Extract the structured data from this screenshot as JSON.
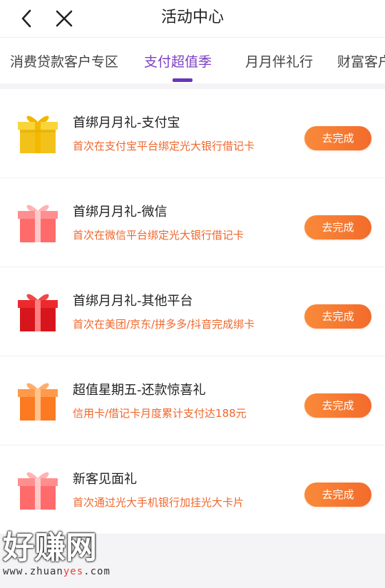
{
  "header": {
    "title": "活动中心",
    "back_icon": "chevron-left-icon",
    "close_icon": "close-icon"
  },
  "tabs": [
    {
      "label": "消费贷款客户专区",
      "active": false
    },
    {
      "label": "支付超值季",
      "active": true
    },
    {
      "label": "月月伴礼行",
      "active": false
    },
    {
      "label": "财富客户",
      "active": false
    }
  ],
  "colors": {
    "accent": "#7c3fc4",
    "orange_text": "#f0672c",
    "button": "#f36b2b"
  },
  "items": [
    {
      "name": "首绑月月礼-支付宝",
      "desc": "首次在支付宝平台绑定光大银行借记卡",
      "button": "去完成",
      "icon": "gold-gift-icon"
    },
    {
      "name": "首绑月月礼-微信",
      "desc": "首次在微信平台绑定光大银行借记卡",
      "button": "去完成",
      "icon": "pink-gift-icon"
    },
    {
      "name": "首绑月月礼-其他平台",
      "desc": "首次在美团/京东/拼多多/抖音完成绑卡",
      "button": "去完成",
      "icon": "red-gift-icon"
    },
    {
      "name": "超值星期五-还款惊喜礼",
      "desc": "信用卡/借记卡月度累计支付达188元",
      "button": "去完成",
      "icon": "orange-gift-icon"
    },
    {
      "name": "新客见面礼",
      "desc": "首次通过光大手机银行加挂光大卡片",
      "button": "去完成",
      "icon": "pink-gift-icon"
    }
  ],
  "watermark": {
    "big": "好赚网",
    "url_prefix": "www.zhuan",
    "url_highlight": "yes",
    "url_suffix": ".com"
  }
}
